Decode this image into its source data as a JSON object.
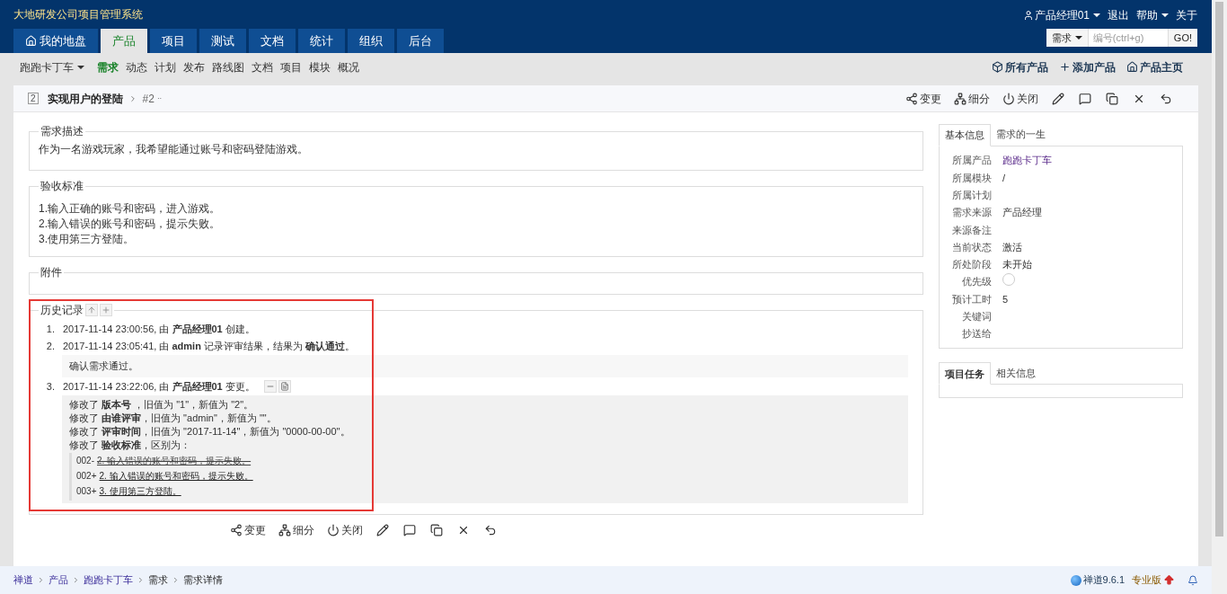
{
  "app_title": "大地研发公司项目管理系统",
  "user_menu": {
    "user": "产品经理01",
    "logout": "退出",
    "help": "帮助",
    "about": "关于"
  },
  "main_tabs": [
    {
      "label": "我的地盘",
      "selected": false,
      "kind": "home"
    },
    {
      "label": "产品",
      "selected": true
    },
    {
      "label": "项目",
      "selected": false
    },
    {
      "label": "测试",
      "selected": false
    },
    {
      "label": "文档",
      "selected": false
    },
    {
      "label": "统计",
      "selected": false
    },
    {
      "label": "组织",
      "selected": false
    },
    {
      "label": "后台",
      "selected": false
    }
  ],
  "search": {
    "type": "需求",
    "placeholder": "编号(ctrl+g)",
    "button": "GO!"
  },
  "sub_nav": {
    "product": "跑跑卡丁车",
    "items": [
      {
        "label": "需求",
        "selected": true
      },
      {
        "label": "动态",
        "selected": false
      },
      {
        "label": "计划",
        "selected": false
      },
      {
        "label": "发布",
        "selected": false
      },
      {
        "label": "路线图",
        "selected": false
      },
      {
        "label": "文档",
        "selected": false
      },
      {
        "label": "项目",
        "selected": false
      },
      {
        "label": "模块",
        "selected": false
      },
      {
        "label": "概况",
        "selected": false
      }
    ],
    "actions": [
      {
        "kind": "box",
        "label": "所有产品"
      },
      {
        "kind": "plus",
        "label": "添加产品"
      },
      {
        "kind": "home",
        "label": "产品主页"
      }
    ]
  },
  "bottom_actions": [
    {
      "kind": "change",
      "label": "变更"
    },
    {
      "kind": "split",
      "label": "细分"
    },
    {
      "kind": "close",
      "label": "关闭"
    },
    {
      "kind": "edit"
    },
    {
      "kind": "comment"
    },
    {
      "kind": "copy"
    },
    {
      "kind": "delete"
    },
    {
      "kind": "back"
    }
  ],
  "story": {
    "id_badge": "2",
    "title": "实现用户的登陆",
    "version": "#2",
    "version_menu": "··",
    "actions": [
      {
        "kind": "change",
        "label": "变更"
      },
      {
        "kind": "split",
        "label": "细分"
      },
      {
        "kind": "close",
        "label": "关闭"
      },
      {
        "kind": "edit"
      },
      {
        "kind": "comment"
      },
      {
        "kind": "copy"
      },
      {
        "kind": "delete"
      },
      {
        "kind": "back"
      }
    ]
  },
  "description": {
    "title": "需求描述",
    "text": "作为一名游戏玩家，我希望能通过账号和密码登陆游戏。"
  },
  "acceptance": {
    "title": "验收标准",
    "lines": [
      "1.输入正确的账号和密码，进入游戏。",
      "2.输入错误的账号和密码，提示失败。",
      "3.使用第三方登陆。"
    ]
  },
  "attachments": {
    "title": "附件"
  },
  "history": {
    "title": "历史记录",
    "entries": [
      {
        "number": "1.",
        "text": "2017-11-14 23:00:56, 由 **产品经理01** 创建。"
      },
      {
        "number": "2.",
        "text": "2017-11-14 23:05:41, 由 **admin** 记录评审结果，结果为 **确认通过**。",
        "comment": "确认需求通过。"
      },
      {
        "number": "3.",
        "text": "2017-11-14 23:22:06, 由 **产品经理01** 变更。",
        "expanded": true,
        "changes": [
          "修改了 **版本号** ，旧值为 \"1\"，新值为 \"2\"。",
          "修改了 **由谁评审**，旧值为 \"admin\"，新值为 \"\"。",
          "修改了 **评审时间**，旧值为 \"2017-11-14\"，新值为 \"0000-00-00\"。",
          "修改了 **验收标准**，区别为："
        ],
        "diff": [
          {
            "kind": "removed",
            "num": "002-",
            "text": "2. 输入错误的账号和密码，提示失败。"
          },
          {
            "kind": "added",
            "num": "002+",
            "text": "2. 输入错误的账号和密码，提示失败。"
          },
          {
            "kind": "added",
            "num": "003+",
            "text": "3. 使用第三方登陆。"
          }
        ]
      }
    ]
  },
  "info_tabs": [
    {
      "label": "基本信息",
      "selected": true
    },
    {
      "label": "需求的一生",
      "selected": false
    }
  ],
  "info_fields": [
    {
      "label": "所属产品",
      "kind": "link",
      "value": "跑跑卡丁车"
    },
    {
      "label": "所属模块",
      "value": "/"
    },
    {
      "label": "所属计划"
    },
    {
      "label": "需求来源",
      "value": "产品经理"
    },
    {
      "label": "来源备注"
    },
    {
      "label": "当前状态",
      "value": "激活"
    },
    {
      "label": "所处阶段",
      "value": "未开始"
    },
    {
      "label": "优先级",
      "kind": "priority"
    },
    {
      "label": "预计工时",
      "value": "5"
    },
    {
      "label": "关键词"
    },
    {
      "label": "抄送给"
    }
  ],
  "task_tabs": [
    {
      "label": "项目任务",
      "selected": true
    },
    {
      "label": "相关信息",
      "selected": false
    }
  ],
  "footer": {
    "breadcrumbs": [
      "禅道",
      "产品",
      "跑跑卡丁车",
      "需求",
      "需求详情"
    ],
    "version": "禅道9.6.1",
    "edition": "专业版"
  }
}
